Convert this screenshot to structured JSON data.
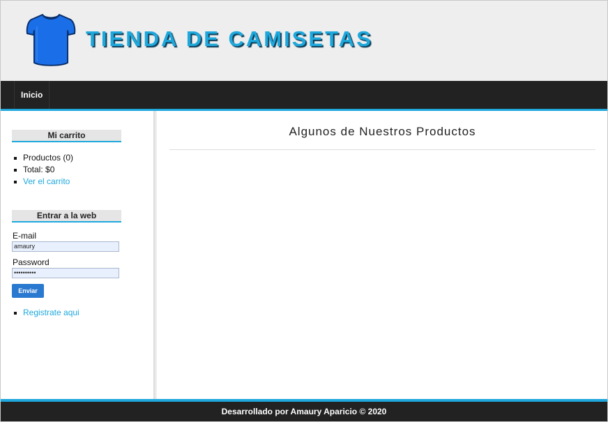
{
  "header": {
    "logo_icon": "tshirt-icon",
    "title": "TIENDA DE CAMISETAS",
    "title_color": "#1ea8dc"
  },
  "nav": {
    "items": [
      {
        "label": "Inicio"
      }
    ]
  },
  "cart": {
    "heading": "Mi carrito",
    "products": "Productos (0)",
    "total": "Total: $0",
    "view_link": "Ver el carrito"
  },
  "login": {
    "heading": "Entrar a la web",
    "email_label": "E-mail",
    "email_value": "amaury",
    "password_label": "Password",
    "password_value": "••••••••••",
    "submit_label": "Enviar",
    "register_link": "Registrate aqui"
  },
  "main": {
    "title": "Algunos de Nuestros Productos"
  },
  "footer": {
    "text": "Desarrollado por Amaury Aparicio © 2020"
  },
  "colors": {
    "accent": "#1ea8dc",
    "nav_bg": "#222222",
    "header_bg": "#eeeeee",
    "button": "#2a79d0"
  }
}
